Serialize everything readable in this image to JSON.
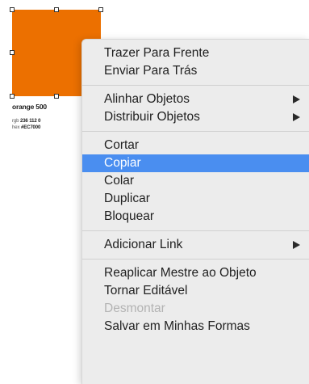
{
  "shape": {
    "fill_color": "#EC7000"
  },
  "swatch": {
    "name": "orange 500",
    "rgb_label": "rgb",
    "rgb_value": "236 112 0",
    "hex_label": "hex",
    "hex_value": "#EC7000"
  },
  "menu": {
    "groups": [
      [
        {
          "label": "Trazer Para Frente"
        },
        {
          "label": "Enviar Para Trás"
        }
      ],
      [
        {
          "label": "Alinhar Objetos",
          "submenu": true
        },
        {
          "label": "Distribuir Objetos",
          "submenu": true
        }
      ],
      [
        {
          "label": "Cortar"
        },
        {
          "label": "Copiar",
          "highlighted": true
        },
        {
          "label": "Colar"
        },
        {
          "label": "Duplicar"
        },
        {
          "label": "Bloquear"
        }
      ],
      [
        {
          "label": "Adicionar Link",
          "submenu": true
        }
      ],
      [
        {
          "label": "Reaplicar Mestre ao Objeto"
        },
        {
          "label": "Tornar Editável"
        },
        {
          "label": "Desmontar",
          "disabled": true
        },
        {
          "label": "Salvar em Minhas Formas"
        }
      ]
    ],
    "highlight_color": "#4a8ef0",
    "background_color": "#ececec"
  }
}
